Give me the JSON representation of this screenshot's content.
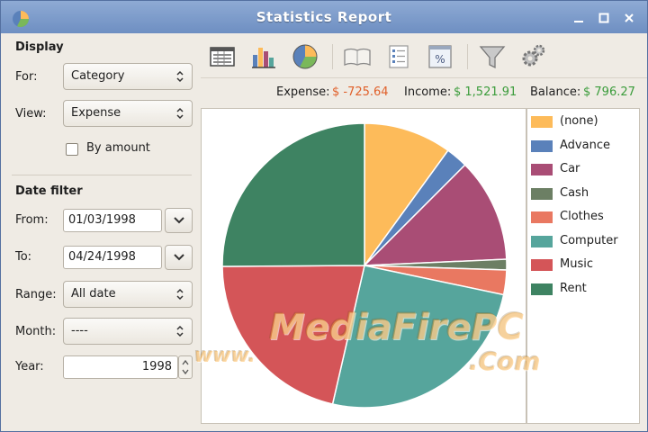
{
  "window": {
    "title": "Statistics Report"
  },
  "display": {
    "heading": "Display",
    "for_label": "For:",
    "for_value": "Category",
    "view_label": "View:",
    "view_value": "Expense",
    "by_amount_label": "By amount",
    "by_amount_checked": false
  },
  "date_filter": {
    "heading": "Date filter",
    "from_label": "From:",
    "from_value": "01/03/1998",
    "to_label": "To:",
    "to_value": "04/24/1998",
    "range_label": "Range:",
    "range_value": "All date",
    "month_label": "Month:",
    "month_value": "----",
    "year_label": "Year:",
    "year_value": "1998"
  },
  "toolbar": {
    "icons": [
      "list-view-icon",
      "bar-chart-icon",
      "pie-chart-icon",
      "book-icon",
      "checklist-icon",
      "percent-icon",
      "filter-icon",
      "settings-icon"
    ]
  },
  "summary": {
    "expense_label": "Expense:",
    "expense_value": "$ -725.64",
    "income_label": "Income:",
    "income_value": "$ 1,521.91",
    "balance_label": "Balance:",
    "balance_value": "$ 796.27",
    "expense_color": "#e0602a",
    "positive_color": "#3b9c3b"
  },
  "chart_data": {
    "type": "pie",
    "categories": [
      "(none)",
      "Advance",
      "Car",
      "Cash",
      "Clothes",
      "Computer",
      "Music",
      "Rent"
    ],
    "values": [
      10.0,
      2.5,
      11.8,
      1.2,
      2.8,
      25.3,
      21.3,
      25.1
    ],
    "colors": [
      "#fdbb5a",
      "#5a81ba",
      "#a94d75",
      "#6c7f64",
      "#e97861",
      "#56a59c",
      "#d45558",
      "#3e8362"
    ],
    "legend": "right"
  },
  "watermark": {
    "text1": "MediaFirePC",
    "text2": ".Com",
    "text3": "www."
  }
}
